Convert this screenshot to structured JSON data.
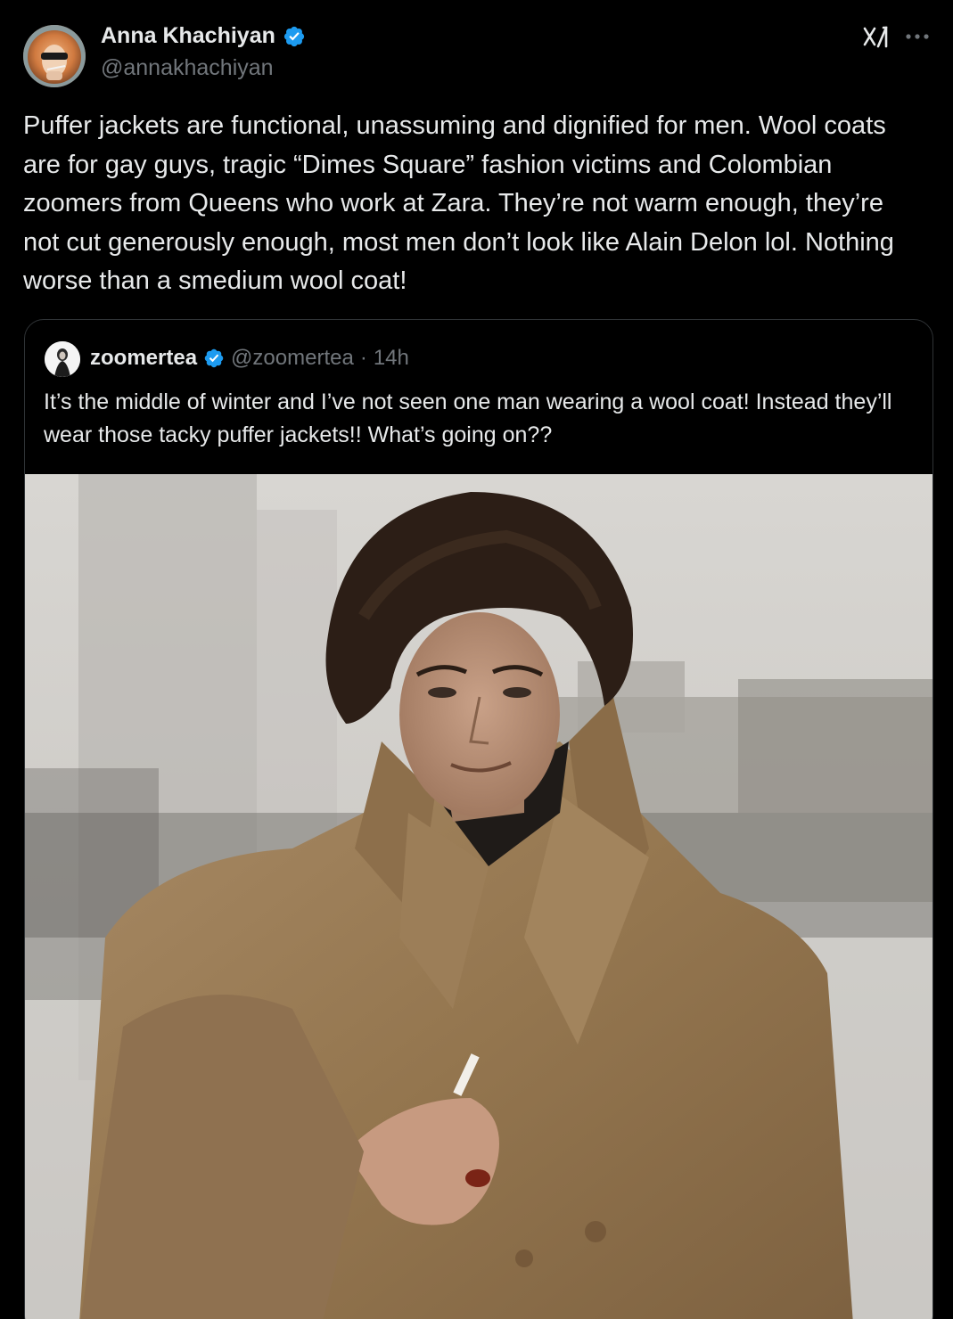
{
  "author": {
    "name": "Anna Khachiyan",
    "handle": "@annakhachiyan",
    "verified": true
  },
  "tweet": {
    "text": "Puffer jackets are functional, unassuming and dignified for men. Wool coats are for gay guys, tragic “Dimes Square” fashion victims and Colombian zoomers from Queens who work at Zara. They’re not warm enough, they’re not cut generously enough, most men don’t look like Alain Delon lol. Nothing worse than a smedium wool coat!"
  },
  "quoted": {
    "name": "zoomertea",
    "handle": "@zoomertea",
    "separator": "·",
    "time": "14h",
    "verified": true,
    "text": "It’s the middle of winter and I’ve not seen one man wearing a wool coat! Instead they’ll wear those tacky puffer jackets!! What’s going on??"
  },
  "icons": {
    "verified": "verified-badge-icon",
    "grok": "grok-icon",
    "more": "more-options-icon"
  },
  "colors": {
    "background": "#000000",
    "text_primary": "#e7e9ea",
    "text_secondary": "#71767b",
    "border": "#2f3336",
    "verified_blue": "#1d9bf0"
  }
}
